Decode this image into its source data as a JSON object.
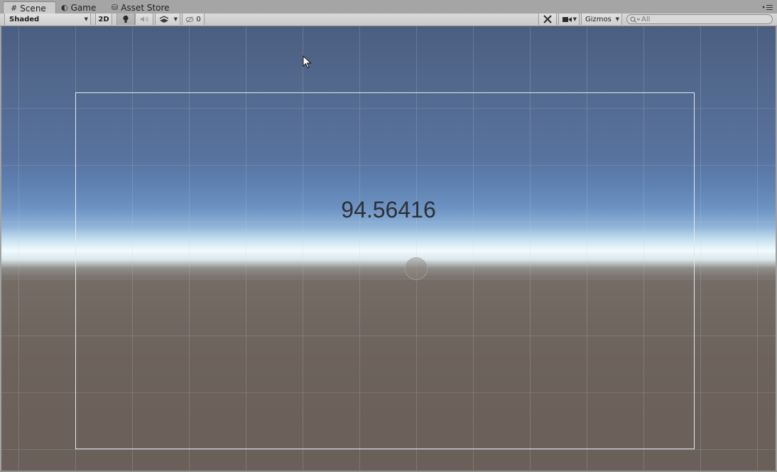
{
  "tabs": [
    {
      "label": "Scene",
      "icon": "grid-icon",
      "active": true
    },
    {
      "label": "Game",
      "icon": "pacman-icon",
      "active": false
    },
    {
      "label": "Asset Store",
      "icon": "bag-icon",
      "active": false
    }
  ],
  "toolbar": {
    "draw_mode": "Shaded",
    "mode_2d": "2D",
    "hidden_count": "0",
    "gizmos": "Gizmos",
    "search_placeholder": "All"
  },
  "scene": {
    "value_text": "94.56416"
  }
}
